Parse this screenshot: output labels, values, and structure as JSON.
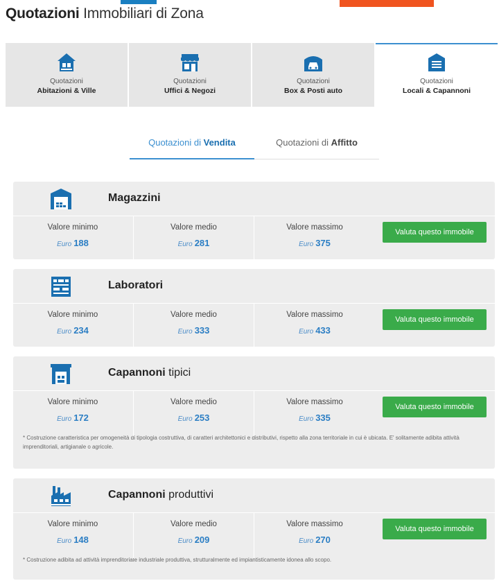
{
  "page": {
    "title_bold": "Quotazioni",
    "title_rest": " Immobiliari di Zona"
  },
  "tabs": [
    {
      "sub": "Quotazioni",
      "main": "Abitazioni & Ville",
      "icon": "house-icon"
    },
    {
      "sub": "Quotazioni",
      "main": "Uffici & Negozi",
      "icon": "shop-icon"
    },
    {
      "sub": "Quotazioni",
      "main": "Box & Posti auto",
      "icon": "garage-car-icon"
    },
    {
      "sub": "Quotazioni",
      "main": "Locali & Capannoni",
      "icon": "warehouse-icon",
      "active": true
    }
  ],
  "subtabs": {
    "sale_prefix": "Quotazioni di ",
    "sale_bold": "Vendita",
    "rent_prefix": "Quotazioni di ",
    "rent_bold": "Affitto"
  },
  "labels": {
    "min": "Valore minimo",
    "avg": "Valore medio",
    "max": "Valore massimo",
    "currency": "Euro",
    "button": "Valuta questo immobile"
  },
  "categories": [
    {
      "title_bold": "Magazzini",
      "title_rest": "",
      "min": "188",
      "avg": "281",
      "max": "375",
      "note": "",
      "icon": "warehouse-icon"
    },
    {
      "title_bold": "Laboratori",
      "title_rest": "",
      "min": "234",
      "avg": "333",
      "max": "433",
      "note": "",
      "icon": "workshop-icon"
    },
    {
      "title_bold": "Capannoni",
      "title_rest": " tipici",
      "min": "172",
      "avg": "253",
      "max": "335",
      "note": "* Costruzione caratteristica per omogeneità di tipologia costruttiva, di caratteri architettonici e distributivi, rispetto alla zona territoriale in cui è ubicata. E' solitamente adibita attività imprenditoriali, artigianale o agricole.",
      "icon": "shed-icon"
    },
    {
      "title_bold": "Capannoni",
      "title_rest": " produttivi",
      "min": "148",
      "avg": "209",
      "max": "270",
      "note": "* Costruzione adibita ad attività imprenditoriale industriale produttiva, strutturalmente ed impiantisticamente idonea allo scopo.",
      "icon": "factory-icon"
    }
  ],
  "colors": {
    "accent": "#3b8fd0",
    "icon": "#1a6fb0",
    "button": "#3aab4a",
    "card_bg": "#ededed",
    "tab_bg": "#e6e6e6"
  }
}
